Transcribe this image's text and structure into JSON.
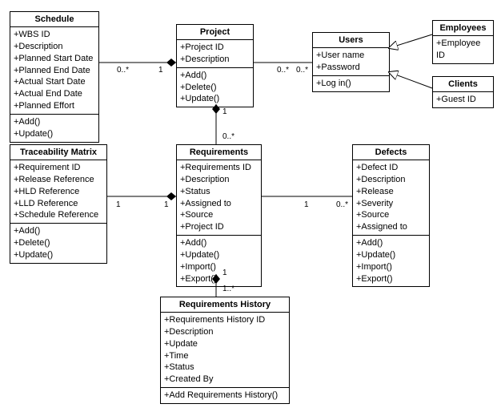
{
  "schedule": {
    "title": "Schedule",
    "attrs": [
      "+WBS ID",
      "+Description",
      "+Planned Start Date",
      "+Planned End Date",
      "+Actual Start Date",
      "+Actual End Date",
      "+Planned Effort"
    ],
    "ops": [
      "+Add()",
      "+Update()"
    ]
  },
  "project": {
    "title": "Project",
    "attrs": [
      "+Project ID",
      "+Description"
    ],
    "ops": [
      "+Add()",
      "+Delete()",
      "+Update()"
    ]
  },
  "users": {
    "title": "Users",
    "attrs": [
      "+User name",
      "+Password"
    ],
    "ops": [
      "+Log in()"
    ]
  },
  "employees": {
    "title": "Employees",
    "attrs": [
      "+Employee ID"
    ]
  },
  "clients": {
    "title": "Clients",
    "attrs": [
      "+Guest ID"
    ]
  },
  "traceability": {
    "title": "Traceability Matrix",
    "attrs": [
      "+Requirement ID",
      "+Release Reference",
      "+HLD Reference",
      "+LLD Reference",
      "+Schedule Reference"
    ],
    "ops": [
      "+Add()",
      "+Delete()",
      "+Update()"
    ]
  },
  "requirements": {
    "title": "Requirements",
    "attrs": [
      "+Requirements ID",
      "+Description",
      "+Status",
      "+Assigned to",
      "+Source",
      "+Project ID"
    ],
    "ops": [
      "+Add()",
      "+Update()",
      "+Import()",
      "+Export()"
    ]
  },
  "defects": {
    "title": "Defects",
    "attrs": [
      "+Defect ID",
      "+Description",
      "+Release",
      "+Severity",
      "+Source",
      "+Assigned to"
    ],
    "ops": [
      "+Add()",
      "+Update()",
      "+Import()",
      "+Export()"
    ]
  },
  "reqhist": {
    "title": "Requirements History",
    "attrs": [
      "+Requirements History ID",
      "+Description",
      "+Update",
      "+Time",
      "+Status",
      "+Created By"
    ],
    "ops": [
      "+Add Requirements History()"
    ]
  },
  "mult": {
    "sched_project_l": "0..*",
    "sched_project_r": "1",
    "project_users_l": "0..*",
    "project_users_r": "0..*",
    "project_req_t": "1",
    "project_req_b": "0..*",
    "trace_req_l": "1",
    "trace_req_r": "1",
    "req_defects_l": "1",
    "req_defects_r": "0..*",
    "req_hist_t": "1",
    "req_hist_b": "1..*"
  },
  "chart_data": {
    "type": "uml-class-diagram",
    "classes": [
      {
        "name": "Schedule",
        "attributes": [
          "WBS ID",
          "Description",
          "Planned Start Date",
          "Planned End Date",
          "Actual Start Date",
          "Actual End Date",
          "Planned Effort"
        ],
        "operations": [
          "Add()",
          "Update()"
        ]
      },
      {
        "name": "Project",
        "attributes": [
          "Project ID",
          "Description"
        ],
        "operations": [
          "Add()",
          "Delete()",
          "Update()"
        ]
      },
      {
        "name": "Users",
        "attributes": [
          "User name",
          "Password"
        ],
        "operations": [
          "Log in()"
        ]
      },
      {
        "name": "Employees",
        "attributes": [
          "Employee ID"
        ],
        "operations": []
      },
      {
        "name": "Clients",
        "attributes": [
          "Guest ID"
        ],
        "operations": []
      },
      {
        "name": "Traceability Matrix",
        "attributes": [
          "Requirement ID",
          "Release Reference",
          "HLD Reference",
          "LLD Reference",
          "Schedule Reference"
        ],
        "operations": [
          "Add()",
          "Delete()",
          "Update()"
        ]
      },
      {
        "name": "Requirements",
        "attributes": [
          "Requirements ID",
          "Description",
          "Status",
          "Assigned to",
          "Source",
          "Project ID"
        ],
        "operations": [
          "Add()",
          "Update()",
          "Import()",
          "Export()"
        ]
      },
      {
        "name": "Defects",
        "attributes": [
          "Defect ID",
          "Description",
          "Release",
          "Severity",
          "Source",
          "Assigned to"
        ],
        "operations": [
          "Add()",
          "Update()",
          "Import()",
          "Export()"
        ]
      },
      {
        "name": "Requirements History",
        "attributes": [
          "Requirements History ID",
          "Description",
          "Update",
          "Time",
          "Status",
          "Created By"
        ],
        "operations": [
          "Add Requirements History()"
        ]
      }
    ],
    "relationships": [
      {
        "type": "composition",
        "from": "Project",
        "to": "Schedule",
        "from_mult": "1",
        "to_mult": "0..*"
      },
      {
        "type": "association",
        "from": "Project",
        "to": "Users",
        "from_mult": "0..*",
        "to_mult": "0..*"
      },
      {
        "type": "composition",
        "from": "Project",
        "to": "Requirements",
        "from_mult": "1",
        "to_mult": "0..*"
      },
      {
        "type": "composition",
        "from": "Requirements",
        "to": "Traceability Matrix",
        "from_mult": "1",
        "to_mult": "1"
      },
      {
        "type": "association",
        "from": "Requirements",
        "to": "Defects",
        "from_mult": "1",
        "to_mult": "0..*"
      },
      {
        "type": "composition",
        "from": "Requirements",
        "to": "Requirements History",
        "from_mult": "1",
        "to_mult": "1..*"
      },
      {
        "type": "generalization",
        "from": "Employees",
        "to": "Users"
      },
      {
        "type": "generalization",
        "from": "Clients",
        "to": "Users"
      }
    ]
  }
}
